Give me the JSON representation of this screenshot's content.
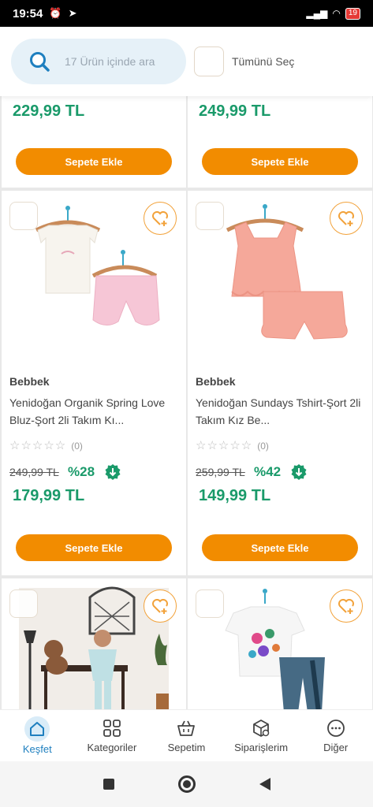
{
  "status": {
    "time": "19:54",
    "battery": "19"
  },
  "header": {
    "search_placeholder": "17 Ürün içinde ara",
    "select_all": "Tümünü Seç"
  },
  "colors": {
    "accent": "#f28c00",
    "price_green": "#1a9a6a",
    "brand_blue": "#1e7fbf"
  },
  "products_top": [
    {
      "price": "229,99 TL",
      "cart_label": "Sepete Ekle"
    },
    {
      "price": "249,99 TL",
      "cart_label": "Sepete Ekle"
    }
  ],
  "products": [
    {
      "brand": "Bebbek",
      "name": "Yenidoğan Organik Spring Love Bluz-Şort 2li Takım Kı...",
      "review_count": "(0)",
      "old_price": "249,99 TL",
      "discount": "%28",
      "price": "179,99 TL",
      "cart_label": "Sepete Ekle"
    },
    {
      "brand": "Bebbek",
      "name": "Yenidoğan Sundays Tshirt-Şort 2li Takım Kız Be...",
      "review_count": "(0)",
      "old_price": "259,99 TL",
      "discount": "%42",
      "price": "149,99 TL",
      "cart_label": "Sepete Ekle"
    }
  ],
  "nav": {
    "items": [
      {
        "label": "Keşfet",
        "icon": "home-icon"
      },
      {
        "label": "Kategoriler",
        "icon": "grid-icon"
      },
      {
        "label": "Sepetim",
        "icon": "basket-icon"
      },
      {
        "label": "Siparişlerim",
        "icon": "package-icon"
      },
      {
        "label": "Diğer",
        "icon": "more-icon"
      }
    ]
  }
}
